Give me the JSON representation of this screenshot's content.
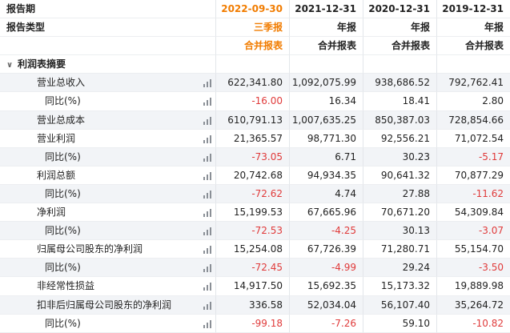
{
  "header": {
    "period_label": "报告期",
    "type_label": "报告类型",
    "columns": [
      {
        "date": "2022-09-30",
        "type": "三季报",
        "subtype": "合并报表"
      },
      {
        "date": "2021-12-31",
        "type": "年报",
        "subtype": "合并报表"
      },
      {
        "date": "2020-12-31",
        "type": "年报",
        "subtype": "合并报表"
      },
      {
        "date": "2019-12-31",
        "type": "年报",
        "subtype": "合并报表"
      }
    ]
  },
  "section": {
    "label": "利润表摘要",
    "chevron": "chevron-down-icon"
  },
  "rows": [
    {
      "label": "营业总收入",
      "level": 1,
      "values": [
        "622,341.80",
        "1,092,075.99",
        "938,686.52",
        "792,762.41"
      ]
    },
    {
      "label": "同比(%)",
      "level": 2,
      "values": [
        "-16.00",
        "16.34",
        "18.41",
        "2.80"
      ]
    },
    {
      "label": "营业总成本",
      "level": 1,
      "values": [
        "610,791.13",
        "1,007,635.25",
        "850,387.03",
        "728,854.66"
      ]
    },
    {
      "label": "营业利润",
      "level": 1,
      "values": [
        "21,365.57",
        "98,771.30",
        "92,556.21",
        "71,072.54"
      ]
    },
    {
      "label": "同比(%)",
      "level": 2,
      "values": [
        "-73.05",
        "6.71",
        "30.23",
        "-5.17"
      ]
    },
    {
      "label": "利润总额",
      "level": 1,
      "values": [
        "20,742.68",
        "94,934.35",
        "90,641.32",
        "70,877.29"
      ]
    },
    {
      "label": "同比(%)",
      "level": 2,
      "values": [
        "-72.62",
        "4.74",
        "27.88",
        "-11.62"
      ]
    },
    {
      "label": "净利润",
      "level": 1,
      "values": [
        "15,199.53",
        "67,665.96",
        "70,671.20",
        "54,309.84"
      ]
    },
    {
      "label": "同比(%)",
      "level": 2,
      "values": [
        "-72.53",
        "-4.25",
        "30.13",
        "-3.07"
      ]
    },
    {
      "label": "归属母公司股东的净利润",
      "level": 1,
      "values": [
        "15,254.08",
        "67,726.39",
        "71,280.71",
        "55,154.70"
      ]
    },
    {
      "label": "同比(%)",
      "level": 2,
      "values": [
        "-72.45",
        "-4.99",
        "29.24",
        "-3.50"
      ]
    },
    {
      "label": "非经常性损益",
      "level": 1,
      "values": [
        "14,917.50",
        "15,692.35",
        "15,173.32",
        "19,889.98"
      ]
    },
    {
      "label": "扣非后归属母公司股东的净利润",
      "level": 1,
      "values": [
        "336.58",
        "52,034.04",
        "56,107.40",
        "35,264.72"
      ]
    },
    {
      "label": "同比(%)",
      "level": 2,
      "values": [
        "-99.18",
        "-7.26",
        "59.10",
        "-10.82"
      ]
    }
  ],
  "row_icon": "bar-chart-icon",
  "colors": {
    "highlight": "#f17c00",
    "negative": "#e03a3a",
    "stripe": "#f2f4f7"
  }
}
